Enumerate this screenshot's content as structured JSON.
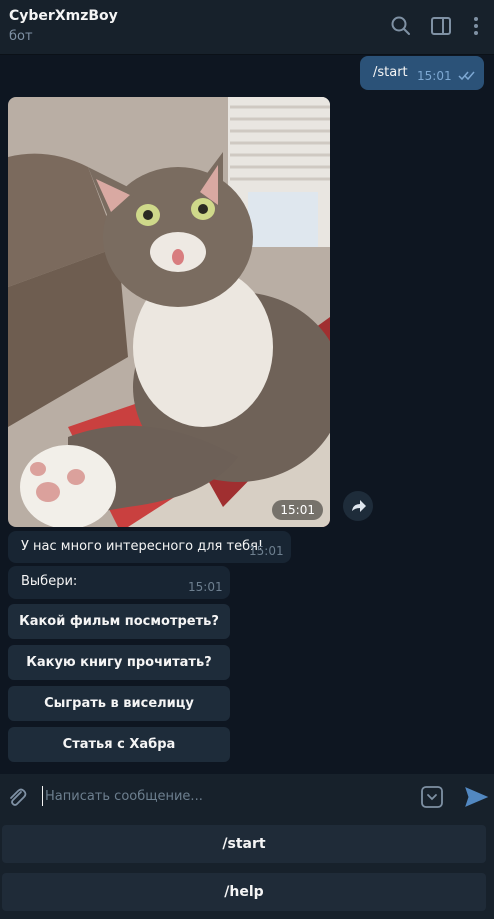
{
  "header": {
    "title": "CyberXmzBoy",
    "subtitle": "бот"
  },
  "messages": {
    "outgoing": {
      "text": "/start",
      "time": "15:01"
    },
    "photo": {
      "time": "15:01"
    },
    "info": {
      "text": "У нас много интересного для тебя!",
      "time": "15:01"
    },
    "choose": {
      "text": "Выбери:",
      "time": "15:01"
    },
    "inline_buttons": [
      "Какой фильм посмотреть?",
      "Какую книгу прочитать?",
      "Сыграть в виселицу",
      "Статья с Хабра"
    ]
  },
  "composer": {
    "placeholder": "Написать сообщение..."
  },
  "keyboard": {
    "buttons": [
      "/start",
      "/help"
    ]
  },
  "colors": {
    "accent": "#5288c1",
    "bubble_out": "#2b5278",
    "bubble_in": "#182533",
    "background": "#0e1621"
  }
}
